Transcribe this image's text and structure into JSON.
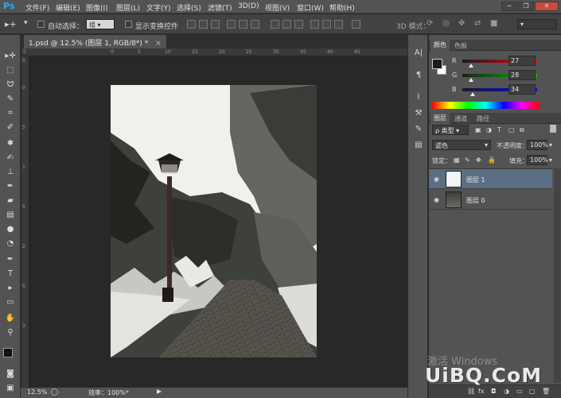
{
  "app": {
    "logo": "Ps"
  },
  "menu": [
    "文件(F)",
    "编辑(E)",
    "图像(I)",
    "图层(L)",
    "文字(Y)",
    "选择(S)",
    "滤镜(T)",
    "3D(D)",
    "视图(V)",
    "窗口(W)",
    "帮助(H)"
  ],
  "window_buttons": {
    "minimize": "−",
    "restore": "❐",
    "close": "✕"
  },
  "options": {
    "auto_select_label": "自动选择：",
    "auto_select_value": "组",
    "show_transform_label": "显示变换控件",
    "mode_3d_label": "3D 模式："
  },
  "document": {
    "tab_title": "1.psd @ 12.5% (图层 1, RGB/8*) *",
    "tab_close": "×"
  },
  "ruler": {
    "top_ticks": [
      "5",
      "0",
      "5",
      "10",
      "15",
      "20",
      "25",
      "30",
      "35",
      "40",
      "45"
    ],
    "left_ticks": [
      "5",
      "0",
      "5",
      "1",
      "5",
      "2",
      "5",
      "3"
    ]
  },
  "status": {
    "zoom": "12.5%",
    "efficiency": "效率：100%*"
  },
  "color_panel": {
    "tabs": [
      "颜色",
      "色板"
    ],
    "active_tab": 0,
    "channels": [
      {
        "label": "R",
        "value": "27",
        "gradient": [
          "#1b1c22",
          "#ff0000"
        ],
        "pos": 0.106
      },
      {
        "label": "G",
        "value": "28",
        "gradient": [
          "#1b1c22",
          "#00c000"
        ],
        "pos": 0.11
      },
      {
        "label": "B",
        "value": "34",
        "gradient": [
          "#1b1c22",
          "#0000ff"
        ],
        "pos": 0.133
      }
    ],
    "foreground": "#1b1c22",
    "background": "#ffffff"
  },
  "layers_panel": {
    "tabs": [
      "图层",
      "通道",
      "路径"
    ],
    "active_tab": 0,
    "filter_label": "ρ 类型",
    "blend_mode": "滤色",
    "opacity_label": "不透明度：",
    "opacity_value": "100%",
    "lock_label": "锁定：",
    "fill_label": "填充：",
    "fill_value": "100%",
    "layers": [
      {
        "name": "图层 1",
        "selected": true,
        "eye": "👁"
      },
      {
        "name": "图层 0",
        "selected": false,
        "eye": "👁"
      }
    ],
    "bottom_icons": [
      "fx",
      "◘",
      "◑",
      "▭",
      "▢",
      "🗑"
    ]
  },
  "watermark": {
    "line1": "激活 Windows",
    "line2": "UiBQ.CoM"
  },
  "colors": {
    "selected_layer": "#5b6e84",
    "panel_bg": "#535353",
    "canvas_bg": "#282828"
  }
}
